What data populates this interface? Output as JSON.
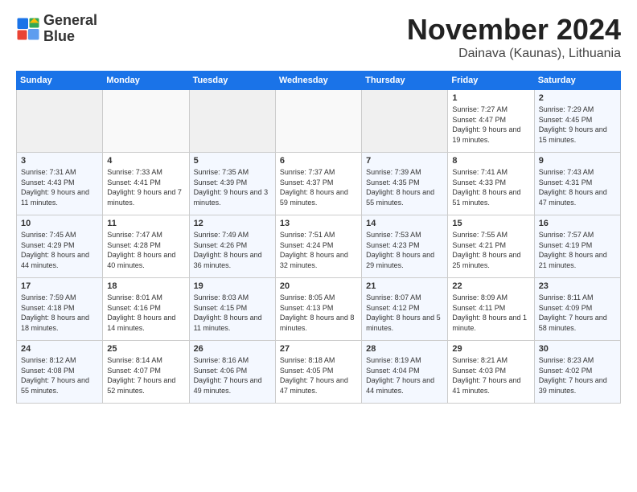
{
  "logo": {
    "line1": "General",
    "line2": "Blue"
  },
  "title": "November 2024",
  "subtitle": "Dainava (Kaunas), Lithuania",
  "weekdays": [
    "Sunday",
    "Monday",
    "Tuesday",
    "Wednesday",
    "Thursday",
    "Friday",
    "Saturday"
  ],
  "weeks": [
    [
      {
        "day": "",
        "info": ""
      },
      {
        "day": "",
        "info": ""
      },
      {
        "day": "",
        "info": ""
      },
      {
        "day": "",
        "info": ""
      },
      {
        "day": "",
        "info": ""
      },
      {
        "day": "1",
        "info": "Sunrise: 7:27 AM\nSunset: 4:47 PM\nDaylight: 9 hours and 19 minutes."
      },
      {
        "day": "2",
        "info": "Sunrise: 7:29 AM\nSunset: 4:45 PM\nDaylight: 9 hours and 15 minutes."
      }
    ],
    [
      {
        "day": "3",
        "info": "Sunrise: 7:31 AM\nSunset: 4:43 PM\nDaylight: 9 hours and 11 minutes."
      },
      {
        "day": "4",
        "info": "Sunrise: 7:33 AM\nSunset: 4:41 PM\nDaylight: 9 hours and 7 minutes."
      },
      {
        "day": "5",
        "info": "Sunrise: 7:35 AM\nSunset: 4:39 PM\nDaylight: 9 hours and 3 minutes."
      },
      {
        "day": "6",
        "info": "Sunrise: 7:37 AM\nSunset: 4:37 PM\nDaylight: 8 hours and 59 minutes."
      },
      {
        "day": "7",
        "info": "Sunrise: 7:39 AM\nSunset: 4:35 PM\nDaylight: 8 hours and 55 minutes."
      },
      {
        "day": "8",
        "info": "Sunrise: 7:41 AM\nSunset: 4:33 PM\nDaylight: 8 hours and 51 minutes."
      },
      {
        "day": "9",
        "info": "Sunrise: 7:43 AM\nSunset: 4:31 PM\nDaylight: 8 hours and 47 minutes."
      }
    ],
    [
      {
        "day": "10",
        "info": "Sunrise: 7:45 AM\nSunset: 4:29 PM\nDaylight: 8 hours and 44 minutes."
      },
      {
        "day": "11",
        "info": "Sunrise: 7:47 AM\nSunset: 4:28 PM\nDaylight: 8 hours and 40 minutes."
      },
      {
        "day": "12",
        "info": "Sunrise: 7:49 AM\nSunset: 4:26 PM\nDaylight: 8 hours and 36 minutes."
      },
      {
        "day": "13",
        "info": "Sunrise: 7:51 AM\nSunset: 4:24 PM\nDaylight: 8 hours and 32 minutes."
      },
      {
        "day": "14",
        "info": "Sunrise: 7:53 AM\nSunset: 4:23 PM\nDaylight: 8 hours and 29 minutes."
      },
      {
        "day": "15",
        "info": "Sunrise: 7:55 AM\nSunset: 4:21 PM\nDaylight: 8 hours and 25 minutes."
      },
      {
        "day": "16",
        "info": "Sunrise: 7:57 AM\nSunset: 4:19 PM\nDaylight: 8 hours and 21 minutes."
      }
    ],
    [
      {
        "day": "17",
        "info": "Sunrise: 7:59 AM\nSunset: 4:18 PM\nDaylight: 8 hours and 18 minutes."
      },
      {
        "day": "18",
        "info": "Sunrise: 8:01 AM\nSunset: 4:16 PM\nDaylight: 8 hours and 14 minutes."
      },
      {
        "day": "19",
        "info": "Sunrise: 8:03 AM\nSunset: 4:15 PM\nDaylight: 8 hours and 11 minutes."
      },
      {
        "day": "20",
        "info": "Sunrise: 8:05 AM\nSunset: 4:13 PM\nDaylight: 8 hours and 8 minutes."
      },
      {
        "day": "21",
        "info": "Sunrise: 8:07 AM\nSunset: 4:12 PM\nDaylight: 8 hours and 5 minutes."
      },
      {
        "day": "22",
        "info": "Sunrise: 8:09 AM\nSunset: 4:11 PM\nDaylight: 8 hours and 1 minute."
      },
      {
        "day": "23",
        "info": "Sunrise: 8:11 AM\nSunset: 4:09 PM\nDaylight: 7 hours and 58 minutes."
      }
    ],
    [
      {
        "day": "24",
        "info": "Sunrise: 8:12 AM\nSunset: 4:08 PM\nDaylight: 7 hours and 55 minutes."
      },
      {
        "day": "25",
        "info": "Sunrise: 8:14 AM\nSunset: 4:07 PM\nDaylight: 7 hours and 52 minutes."
      },
      {
        "day": "26",
        "info": "Sunrise: 8:16 AM\nSunset: 4:06 PM\nDaylight: 7 hours and 49 minutes."
      },
      {
        "day": "27",
        "info": "Sunrise: 8:18 AM\nSunset: 4:05 PM\nDaylight: 7 hours and 47 minutes."
      },
      {
        "day": "28",
        "info": "Sunrise: 8:19 AM\nSunset: 4:04 PM\nDaylight: 7 hours and 44 minutes."
      },
      {
        "day": "29",
        "info": "Sunrise: 8:21 AM\nSunset: 4:03 PM\nDaylight: 7 hours and 41 minutes."
      },
      {
        "day": "30",
        "info": "Sunrise: 8:23 AM\nSunset: 4:02 PM\nDaylight: 7 hours and 39 minutes."
      }
    ]
  ]
}
